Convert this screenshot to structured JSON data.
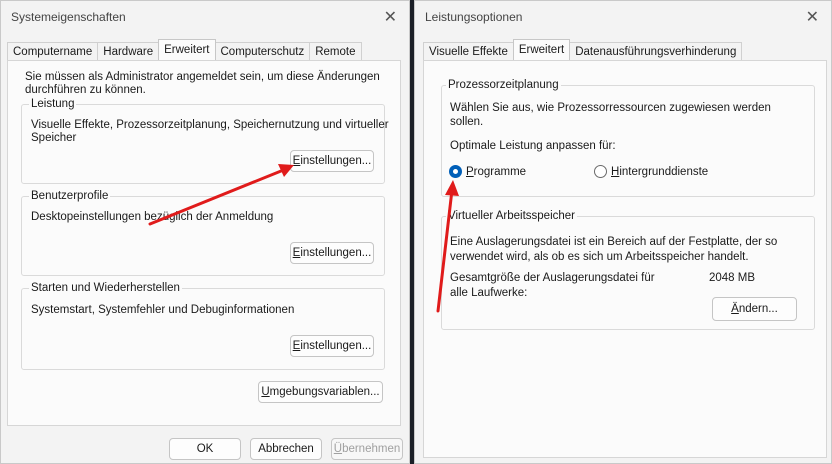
{
  "sys": {
    "title": "Systemeigenschaften",
    "tabs": [
      {
        "label": "Computername"
      },
      {
        "label": "Hardware"
      },
      {
        "label": "Erweitert"
      },
      {
        "label": "Computerschutz"
      },
      {
        "label": "Remote"
      }
    ],
    "admin_notice_1": "Sie müssen als Administrator angemeldet sein, um diese Änderungen",
    "admin_notice_2": "durchführen zu können.",
    "groups": {
      "performance": {
        "label": "Leistung",
        "desc_1": "Visuelle Effekte, Prozessorzeitplanung, Speichernutzung und virtueller",
        "desc_2": "Speicher",
        "button_m": "E",
        "button_rest": "instellungen..."
      },
      "profiles": {
        "label": "Benutzerprofile",
        "desc": "Desktopeinstellungen bezüglich der Anmeldung",
        "button_m": "E",
        "button_rest": "instellungen..."
      },
      "startup": {
        "label": "Starten und Wiederherstellen",
        "desc": "Systemstart, Systemfehler und Debuginformationen",
        "button_m": "E",
        "button_rest": "instellungen..."
      }
    },
    "env_button_m": "U",
    "env_button_rest": "mgebungsvariablen...",
    "ok": "OK",
    "cancel": "Abbrechen",
    "apply_m": "Ü",
    "apply_rest": "bernehmen"
  },
  "perf": {
    "title": "Leistungsoptionen",
    "tabs": [
      {
        "label": "Visuelle Effekte"
      },
      {
        "label": "Erweitert"
      },
      {
        "label": "Datenausführungsverhinderung"
      }
    ],
    "cpu_group": {
      "label": "Prozessorzeitplanung",
      "desc_1": "Wählen Sie aus, wie Prozessorressourcen zugewiesen werden",
      "desc_2": "sollen.",
      "optimize_label": "Optimale Leistung anpassen für:",
      "programs_m": "P",
      "programs_rest": "rogramme",
      "background_m": "H",
      "background_rest": "intergrunddienste"
    },
    "vm_group": {
      "label": "Virtueller Arbeitsspeicher",
      "desc_1": "Eine Auslagerungsdatei ist ein Bereich auf der Festplatte, der so",
      "desc_2": "verwendet wird, als ob es sich um Arbeitsspeicher handelt.",
      "total_label_1": "Gesamtgröße der Auslagerungsdatei für",
      "total_label_2": "alle Laufwerke:",
      "total_value": "2048 MB",
      "change_m": "Ä",
      "change_rest": "ndern..."
    }
  },
  "colors": {
    "annotation_arrow": "#e01b1b",
    "radio_accent": "#005fb8"
  }
}
